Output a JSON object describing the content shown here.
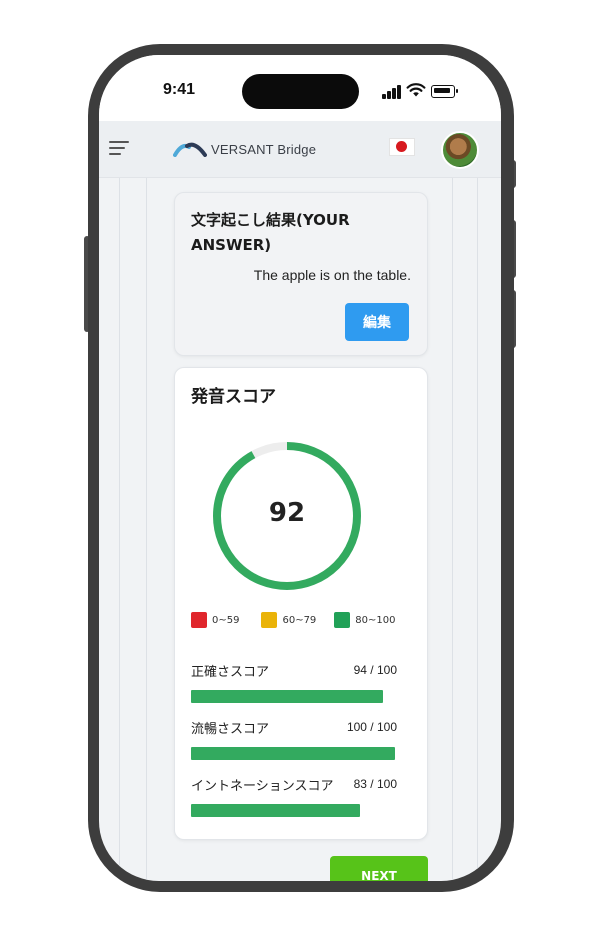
{
  "status_bar": {
    "time": "9:41"
  },
  "header": {
    "brand": "VERSANT Bridge",
    "language_flag": "japan-flag",
    "menu_icon": "hamburger-icon",
    "avatar_icon": "user-avatar"
  },
  "transcription_card": {
    "title_line1": "文字起こし結果(YOUR",
    "title_line2": "ANSWER)",
    "text": "The apple is on the table.",
    "edit_label": "編集"
  },
  "pronunciation_card": {
    "title": "発音スコア",
    "score": 92,
    "score_max": 100,
    "legend": [
      {
        "label": "0~59",
        "color": "#e0262c"
      },
      {
        "label": "60~79",
        "color": "#eab308"
      },
      {
        "label": "80~100",
        "color": "#21a157"
      }
    ],
    "metrics": [
      {
        "label": "正確さスコア",
        "value": 94,
        "display": "94 / 100"
      },
      {
        "label": "流暢さスコア",
        "value": 100,
        "display": "100 / 100"
      },
      {
        "label": "イントネーションスコア",
        "value": 83,
        "display": "83 / 100"
      }
    ]
  },
  "footer": {
    "next_label": "NEXT"
  },
  "colors": {
    "accent_blue": "#2f9bf0",
    "score_green": "#33aa5f",
    "next_green": "#57c319"
  }
}
